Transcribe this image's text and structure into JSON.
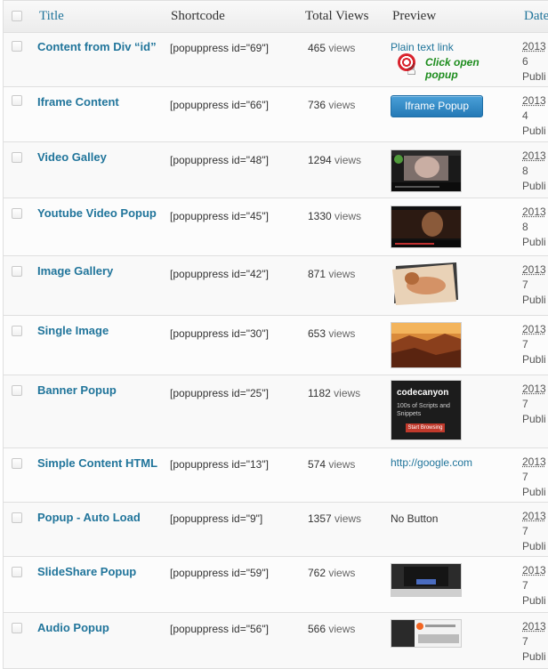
{
  "header": {
    "title": "Title",
    "shortcode": "Shortcode",
    "views": "Total Views",
    "preview": "Preview",
    "date": "Date"
  },
  "views_unit": "views",
  "rows": [
    {
      "title": "Content from Div “id”",
      "shortcode": "[popuppress id=\"69\"]",
      "views": "465",
      "preview_type": "link",
      "preview": "Plain text link",
      "date_year": "2013",
      "date_day": "6",
      "status": "Publi"
    },
    {
      "title": "Iframe Content",
      "shortcode": "[popuppress id=\"66\"]",
      "views": "736",
      "preview_type": "button",
      "preview": "Iframe Popup",
      "date_year": "2013",
      "date_day": "4",
      "status": "Publi"
    },
    {
      "title": "Video Galley",
      "shortcode": "[popuppress id=\"48\"]",
      "views": "1294",
      "preview_type": "thumb",
      "thumb": "video-gallery-thumbnail",
      "date_year": "2013",
      "date_day": "8",
      "status": "Publi"
    },
    {
      "title": "Youtube Video Popup",
      "shortcode": "[popuppress id=\"45\"]",
      "views": "1330",
      "preview_type": "thumb",
      "thumb": "youtube-video-thumbnail",
      "date_year": "2013",
      "date_day": "8",
      "status": "Publi"
    },
    {
      "title": "Image Gallery",
      "shortcode": "[popuppress id=\"42\"]",
      "views": "871",
      "preview_type": "thumb",
      "thumb": "image-gallery-thumbnail",
      "date_year": "2013",
      "date_day": "7",
      "status": "Publi"
    },
    {
      "title": "Single Image",
      "shortcode": "[popuppress id=\"30\"]",
      "views": "653",
      "preview_type": "thumb",
      "thumb": "canyon-image-thumbnail",
      "date_year": "2013",
      "date_day": "7",
      "status": "Publi"
    },
    {
      "title": "Banner Popup",
      "shortcode": "[popuppress id=\"25\"]",
      "views": "1182",
      "preview_type": "banner",
      "banner_brand": "codecanyon",
      "banner_text": "100s of Scripts and Snippets",
      "banner_cta": "Start Browsing",
      "date_year": "2013",
      "date_day": "7",
      "status": "Publi"
    },
    {
      "title": "Simple Content HTML",
      "shortcode": "[popuppress id=\"13\"]",
      "views": "574",
      "preview_type": "link",
      "preview": "http://google.com",
      "date_year": "2013",
      "date_day": "7",
      "status": "Publi"
    },
    {
      "title": "Popup - Auto Load",
      "shortcode": "[popuppress id=\"9\"]",
      "views": "1357",
      "preview_type": "text",
      "preview": "No Button",
      "date_year": "2013",
      "date_day": "7",
      "status": "Publi"
    },
    {
      "title": "SlideShare Popup",
      "shortcode": "[popuppress id=\"59\"]",
      "views": "762",
      "preview_type": "thumb",
      "thumb": "slideshare-thumbnail",
      "date_year": "2013",
      "date_day": "7",
      "status": "Publi"
    },
    {
      "title": "Audio Popup",
      "shortcode": "[popuppress id=\"56\"]",
      "views": "566",
      "preview_type": "thumb",
      "thumb": "audio-player-thumbnail",
      "date_year": "2013",
      "date_day": "7",
      "status": "Publi"
    }
  ],
  "click_hint": "Click open popup",
  "colors": {
    "link": "#21759b",
    "hint_green": "#1e8d1e",
    "target_red": "#d9232d",
    "button_blue": "#2479b6"
  }
}
